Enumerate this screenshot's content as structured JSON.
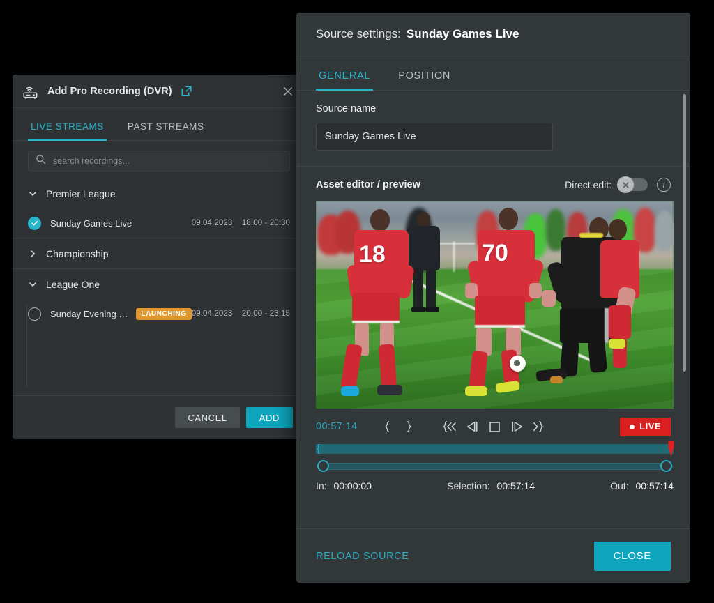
{
  "dvr_dialog": {
    "icon": "dvr-receiver-icon",
    "title": "Add Pro Recording (DVR)",
    "external_link_icon": "external-link-icon",
    "close_icon": "close-icon",
    "tabs": [
      {
        "label": "LIVE STREAMS",
        "active": true
      },
      {
        "label": "PAST STREAMS",
        "active": false
      }
    ],
    "search": {
      "icon": "search-icon",
      "value": "",
      "placeholder": "search recordings..."
    },
    "groups": [
      {
        "name": "Premier League",
        "expanded": true,
        "chevron": "chevron-down-icon",
        "items": [
          {
            "selected": true,
            "name": "Sunday Games Live",
            "badge": "",
            "date": "09.04.2023",
            "time": "18:00 - 20:30"
          }
        ]
      },
      {
        "name": "Championship",
        "expanded": false,
        "chevron": "chevron-right-icon",
        "items": []
      },
      {
        "name": "League One",
        "expanded": true,
        "chevron": "chevron-down-icon",
        "items": [
          {
            "selected": false,
            "name": "Sunday Evening Gam…",
            "badge": "LAUNCHING",
            "date": "09.04.2023",
            "time": "20:00 - 23:15"
          }
        ]
      }
    ],
    "footer": {
      "cancel_label": "CANCEL",
      "add_label": "ADD"
    }
  },
  "source_settings": {
    "header_label": "Source settings:",
    "header_name": "Sunday Games Live",
    "tabs": [
      {
        "label": "GENERAL",
        "active": true
      },
      {
        "label": "POSITION",
        "active": false
      }
    ],
    "source_name": {
      "label": "Source name",
      "value": "Sunday Games Live",
      "placeholder": "Source name"
    },
    "asset_editor": {
      "title": "Asset editor / preview",
      "direct_edit_label": "Direct edit:",
      "direct_edit_on": false,
      "toggle_icon": "cross-icon",
      "info_icon": "info-icon"
    },
    "player": {
      "timecode": "00:57:14",
      "controls": [
        {
          "name": "set-in-point-button",
          "glyph": "{"
        },
        {
          "name": "set-out-point-button",
          "glyph": "}"
        },
        {
          "name": "jump-to-start-button",
          "glyph": "{<"
        },
        {
          "name": "step-back-button",
          "glyph": "<|"
        },
        {
          "name": "stop-button",
          "glyph": "[]"
        },
        {
          "name": "step-forward-button",
          "glyph": "|>"
        },
        {
          "name": "jump-to-end-button",
          "glyph": ">}"
        }
      ],
      "live_label": "LIVE",
      "live_indicator_icon": "live-dot-icon",
      "timeline_progress_pct": 100,
      "in_key": "In:",
      "in_value": "00:00:00",
      "selection_key": "Selection:",
      "selection_value": "00:57:14",
      "out_key": "Out:",
      "out_value": "00:57:14"
    },
    "footer": {
      "reload_label": "RELOAD SOURCE",
      "close_label": "CLOSE"
    }
  },
  "colors": {
    "accent_teal": "#0ea5bd",
    "accent_teal_text": "#26b5c9",
    "badge_orange": "#e0982e",
    "live_red": "#d91f1f",
    "panel_bg": "#32373a",
    "dialog_bg": "#2e3235",
    "page_bg": "#000000"
  }
}
